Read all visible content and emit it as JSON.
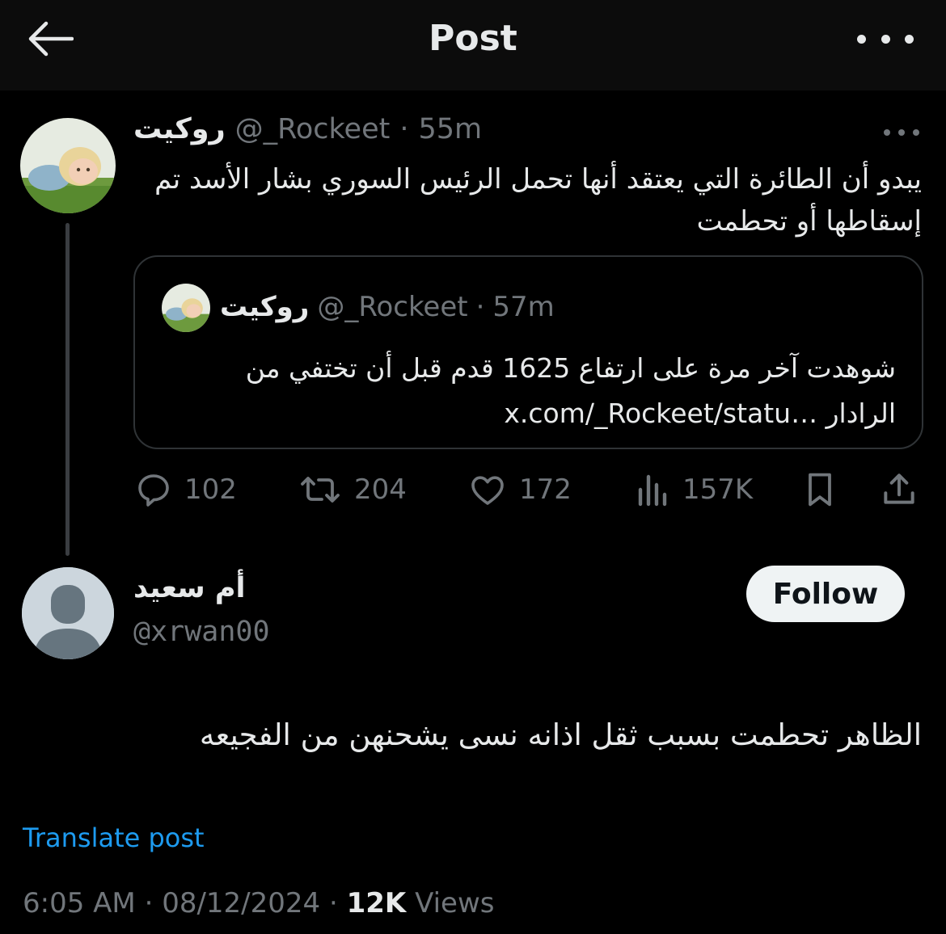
{
  "header": {
    "title": "Post"
  },
  "parent": {
    "display_name": "روكيت",
    "handle": "@_Rockeet",
    "sep": "·",
    "time": "55m",
    "text": "يبدو أن الطائرة التي يعتقد أنها تحمل الرئيس السوري بشار الأسد تم إسقاطها أو تحطمت",
    "quote": {
      "display_name": "روكيت",
      "handle": "@_Rockeet",
      "sep": "·",
      "time": "57m",
      "text": "شوهدت آخر مرة على ارتفاع 1625 قدم قبل أن تختفي من الرادار",
      "link": "x.com/_Rockeet/statu…"
    },
    "stats": {
      "replies": "102",
      "reposts": "204",
      "likes": "172",
      "views": "157K"
    }
  },
  "reply": {
    "display_name": "أم سعيد",
    "handle": "@xrwan00",
    "follow_label": "Follow",
    "text": "الظاهر تحطمت بسبب ثقل اذانه نسى يشحنهن من الفجيعه",
    "translate_label": "Translate post",
    "time": "6:05 AM",
    "sep": "·",
    "date": "08/12/2024",
    "views_count": "12K",
    "views_label": "Views"
  },
  "colors": {
    "background": "#000000",
    "text": "#e7e9ea",
    "muted": "#71767b",
    "link": "#1d9bf0",
    "border": "#2f3336"
  },
  "icons": [
    "back-arrow-icon",
    "more-icon",
    "reply-icon",
    "repost-icon",
    "like-icon",
    "views-icon",
    "bookmark-icon",
    "share-icon"
  ]
}
